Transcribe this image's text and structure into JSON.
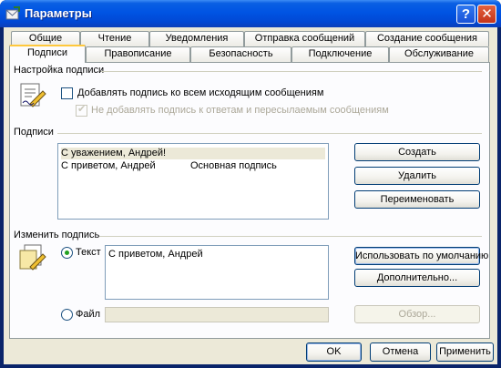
{
  "window": {
    "title": "Параметры",
    "help_button": "?",
    "close_button": "✕"
  },
  "tabs": {
    "row_back": [
      "Общие",
      "Чтение",
      "Уведомления",
      "Отправка сообщений",
      "Создание сообщения"
    ],
    "row_front": [
      "Подписи",
      "Правописание",
      "Безопасность",
      "Подключение",
      "Обслуживание"
    ],
    "active": "Подписи"
  },
  "signature_settings": {
    "group_label": "Настройка подписи",
    "add_to_all_label": "Добавлять подпись ко всем исходящим сообщениям",
    "add_to_all_checked": false,
    "no_reply_label": "Не добавлять подпись к ответам и пересылаемым сообщениям",
    "no_reply_checked": true
  },
  "signatures": {
    "group_label": "Подписи",
    "rows": [
      {
        "name": "С уважением, Андрей!",
        "note": ""
      },
      {
        "name": "С приветом, Андрей",
        "note": "Основная подпись"
      }
    ],
    "create_button": "Создать",
    "delete_button": "Удалить",
    "rename_button": "Переименовать"
  },
  "edit_signature": {
    "group_label": "Изменить подпись",
    "text_radio_label": "Текст",
    "text_value": "С приветом, Андрей",
    "file_radio_label": "Файл",
    "file_value": "",
    "set_default_button": "Использовать по умолчанию",
    "advanced_button": "Дополнительно...",
    "browse_button": "Обзор..."
  },
  "footer": {
    "ok_button": "OK",
    "cancel_button": "Отмена",
    "apply_button": "Применить"
  }
}
